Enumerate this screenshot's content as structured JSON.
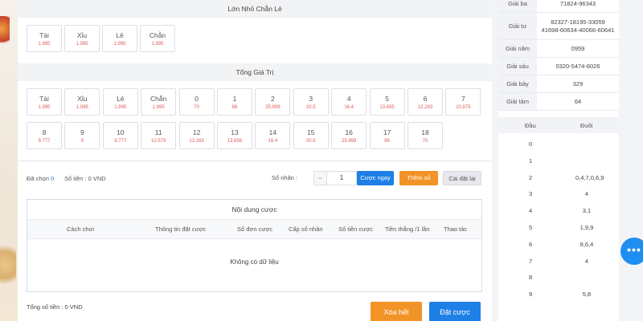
{
  "section1": {
    "title": "Lớn Nhỏ Chẵn Lẻ",
    "cells": [
      {
        "name": "Tài",
        "odds": "1.995"
      },
      {
        "name": "Xỉu",
        "odds": "1.995"
      },
      {
        "name": "Lẻ",
        "odds": "1.995"
      },
      {
        "name": "Chẵn",
        "odds": "1.995"
      }
    ]
  },
  "section2": {
    "title": "Tổng Giá Trị",
    "cells": [
      {
        "name": "Tài",
        "odds": "1.995"
      },
      {
        "name": "Xỉu",
        "odds": "1.995"
      },
      {
        "name": "Lẻ",
        "odds": "1.995"
      },
      {
        "name": "Chẵn",
        "odds": "1.995"
      },
      {
        "name": "0",
        "odds": "70"
      },
      {
        "name": "1",
        "odds": "86"
      },
      {
        "name": "2",
        "odds": "25.999"
      },
      {
        "name": "3",
        "odds": "20.5"
      },
      {
        "name": "4",
        "odds": "16.4"
      },
      {
        "name": "5",
        "odds": "13.655"
      },
      {
        "name": "6",
        "odds": "12.283"
      },
      {
        "name": "7",
        "odds": "10.875"
      },
      {
        "name": "8",
        "odds": "9.777"
      },
      {
        "name": "9",
        "odds": "9"
      },
      {
        "name": "10",
        "odds": "9.777"
      },
      {
        "name": "11",
        "odds": "10.579"
      },
      {
        "name": "12",
        "odds": "12.283"
      },
      {
        "name": "13",
        "odds": "13.656"
      },
      {
        "name": "14",
        "odds": "16.4"
      },
      {
        "name": "15",
        "odds": "20.5"
      },
      {
        "name": "16",
        "odds": "25.999"
      },
      {
        "name": "17",
        "odds": "86"
      },
      {
        "name": "18",
        "odds": "70"
      }
    ]
  },
  "controls": {
    "selected_label": "Đã chọn",
    "selected_count": "0",
    "amount_label": "Số tiền : 0 VND",
    "multiplier_label": "Số nhân :",
    "minus": "−",
    "plus": "+",
    "multiplier_value": "1",
    "bet_now": "Cược ngay",
    "add_number": "Thêm số",
    "reset": "Cài đặt lại"
  },
  "content": {
    "title": "Nội dung cược",
    "headers": [
      "Cách chơi",
      "Thông tin đặt cược",
      "Số đơn cược",
      "Cấp số nhân",
      "Số tiền cược",
      "Tiền thắng /1 lần",
      "Thao tác"
    ],
    "empty": "Không có dữ liệu"
  },
  "footer": {
    "total": "Tổng số tiền : 0 VND",
    "clear_all": "Xóa hết",
    "place_bet": "Đặt cược"
  },
  "results": [
    {
      "label": "Giải ba",
      "value": "71824-96343"
    },
    {
      "label": "Giải tư",
      "value": "82327-18195-33059\n41698-60634-40066-60641"
    },
    {
      "label": "Giải năm",
      "value": "0959"
    },
    {
      "label": "Giải sáu",
      "value": "0320-5474-6026"
    },
    {
      "label": "Giải bảy",
      "value": "329"
    },
    {
      "label": "Giải tám",
      "value": "64"
    }
  ],
  "dau_duoi": {
    "head_label": "Đầu",
    "tail_label": "Đuôi",
    "rows": [
      {
        "dau": "0",
        "duoi": ""
      },
      {
        "dau": "1",
        "duoi": ""
      },
      {
        "dau": "2",
        "duoi": "0,4,7,0,6,9"
      },
      {
        "dau": "3",
        "duoi": "4"
      },
      {
        "dau": "4",
        "duoi": "3,1"
      },
      {
        "dau": "5",
        "duoi": "1,9,9"
      },
      {
        "dau": "6",
        "duoi": "8,6,4"
      },
      {
        "dau": "7",
        "duoi": "4"
      },
      {
        "dau": "8",
        "duoi": ""
      },
      {
        "dau": "9",
        "duoi": "5,8"
      }
    ]
  },
  "float_button": "•••"
}
